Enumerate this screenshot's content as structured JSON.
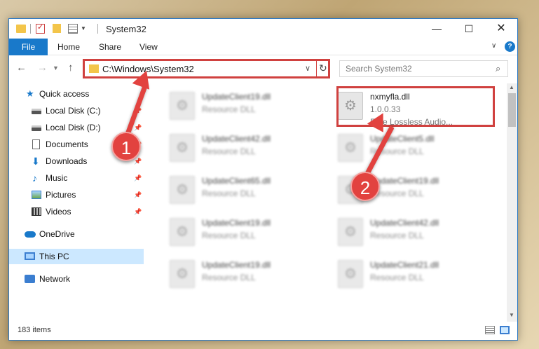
{
  "window": {
    "title": "System32",
    "min_glyph": "—",
    "max_glyph": "☐",
    "close_glyph": "✕"
  },
  "ribbon": {
    "tabs": [
      "File",
      "Home",
      "Share",
      "View"
    ],
    "help": "?"
  },
  "address": {
    "path": "C:\\Windows\\System32",
    "search_placeholder": "Search System32"
  },
  "sidebar": {
    "items": [
      {
        "label": "Quick access",
        "icon": "star-icon",
        "pinned": false
      },
      {
        "label": "Local Disk (C:)",
        "icon": "disk-icon",
        "pinned": true
      },
      {
        "label": "Local Disk (D:)",
        "icon": "disk-icon",
        "pinned": true
      },
      {
        "label": "Documents",
        "icon": "documents-icon",
        "pinned": true
      },
      {
        "label": "Downloads",
        "icon": "downloads-icon",
        "pinned": true
      },
      {
        "label": "Music",
        "icon": "music-icon",
        "pinned": true
      },
      {
        "label": "Pictures",
        "icon": "pictures-icon",
        "pinned": true
      },
      {
        "label": "Videos",
        "icon": "videos-icon",
        "pinned": true
      },
      {
        "label": "OneDrive",
        "icon": "onedrive-icon",
        "pinned": false
      },
      {
        "label": "This PC",
        "icon": "pc-icon",
        "pinned": false,
        "selected": true
      },
      {
        "label": "Network",
        "icon": "network-icon",
        "pinned": false
      }
    ]
  },
  "files": {
    "left": [
      {
        "name": "UpdateClient19.dll",
        "type": "Resource DLL"
      },
      {
        "name": "UpdateClient42.dll",
        "type": "Resource DLL"
      },
      {
        "name": "UpdateClient65.dll",
        "type": "Resource DLL"
      },
      {
        "name": "UpdateClient19.dll",
        "type": "Resource DLL"
      },
      {
        "name": "UpdateClient19.dll",
        "type": "Resource DLL"
      }
    ],
    "right": [
      {
        "name": "nxmyfla.dll",
        "version": "1.0.0.33",
        "type": "Free Lossless Audio..."
      },
      {
        "name": "UpdateClient5.dll",
        "type": "Resource DLL"
      },
      {
        "name": "UpdateClient19.dll",
        "type": "Resource DLL"
      },
      {
        "name": "UpdateClient42.dll",
        "type": "Resource DLL"
      },
      {
        "name": "UpdateClient21.dll",
        "type": "Resource DLL"
      }
    ]
  },
  "status": {
    "count": "183 items"
  },
  "callouts": {
    "one": "1",
    "two": "2"
  },
  "colors": {
    "accent": "#1979ca",
    "highlight": "#d0413f",
    "callout": "#e2423f"
  }
}
